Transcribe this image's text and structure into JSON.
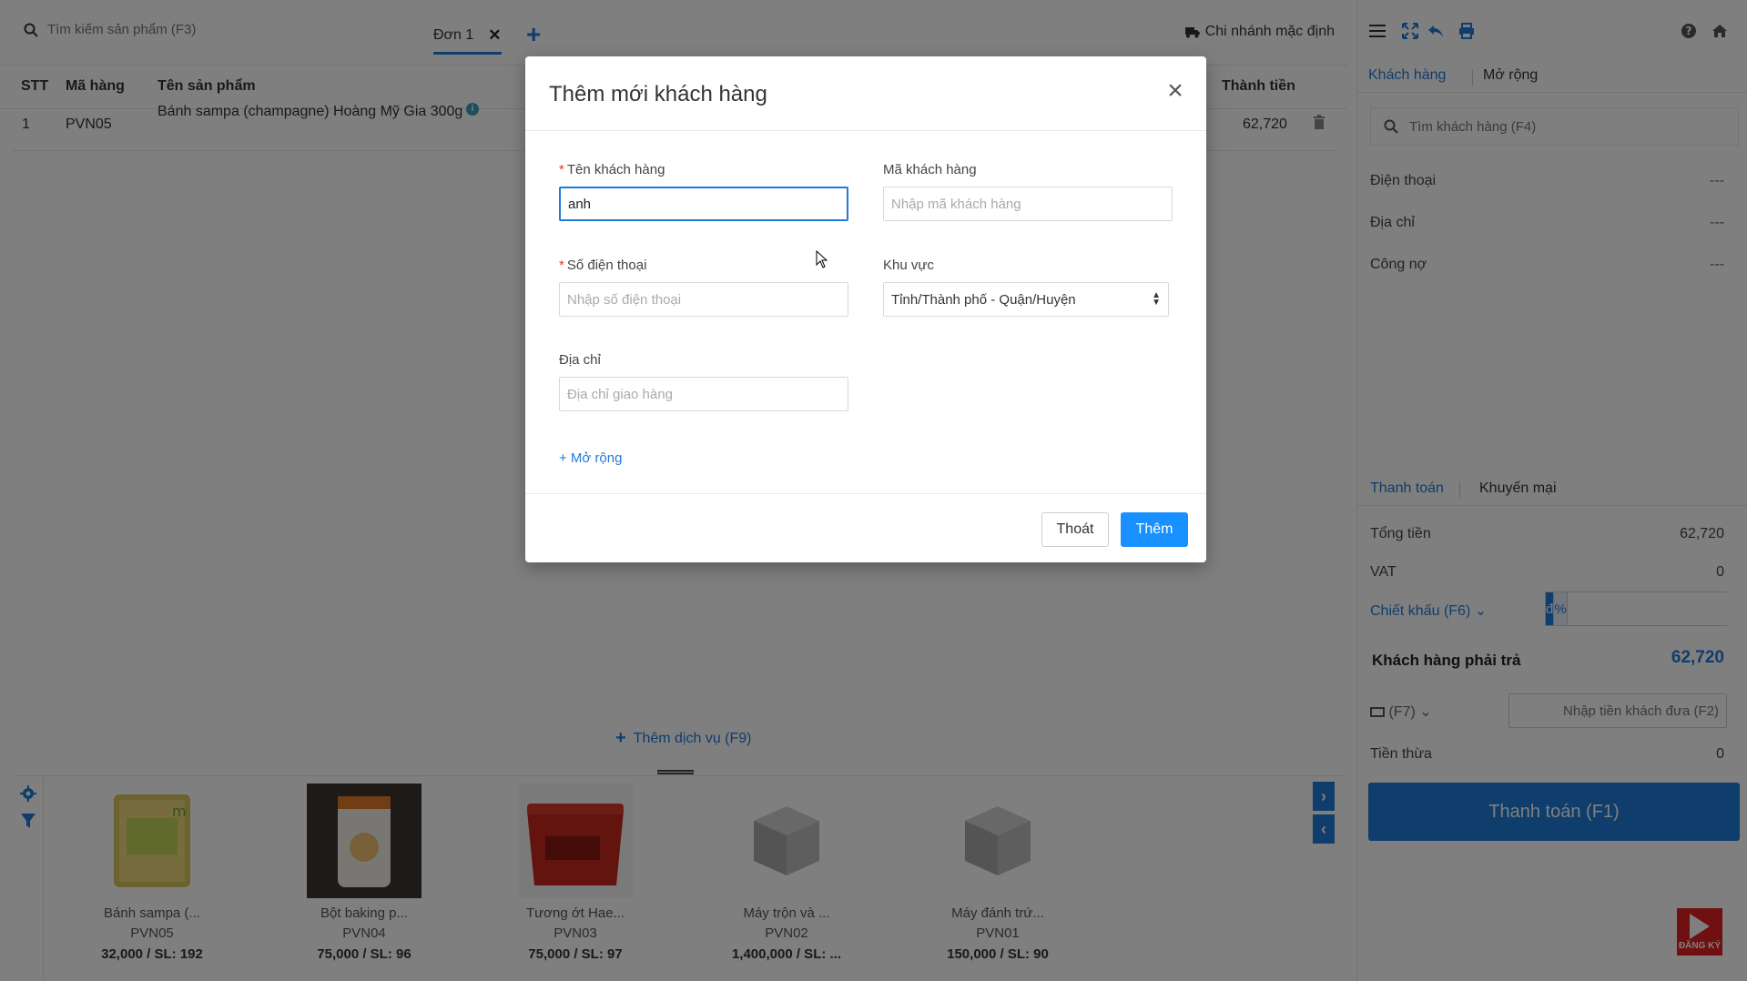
{
  "topbar": {
    "search_placeholder": "Tìm kiếm sản phẩm (F3)",
    "order_tab": "Đơn 1",
    "add_tab": "+",
    "branch": "Chi nhánh mặc định"
  },
  "table": {
    "headers": {
      "stt": "STT",
      "code": "Mã hàng",
      "name": "Tên sản phẩm",
      "total": "Thành tiền"
    },
    "rows": [
      {
        "stt": "1",
        "code": "PVN05",
        "name": "Bánh sampa (champagne) Hoàng Mỹ Gia 300g",
        "total": "62,720"
      }
    ]
  },
  "add_service": "Thêm dịch vụ (F9)",
  "products": [
    {
      "name": "Bánh sampa (...",
      "code": "PVN05",
      "price": "32,000 / SL: 192"
    },
    {
      "name": "Bột baking p...",
      "code": "PVN04",
      "price": "75,000 / SL: 96"
    },
    {
      "name": "Tương ớt Hae...",
      "code": "PVN03",
      "price": "75,000 / SL: 97"
    },
    {
      "name": "Máy trộn và ...",
      "code": "PVN02",
      "price": "1,400,000 / SL: ..."
    },
    {
      "name": "Máy đánh trứ...",
      "code": "PVN01",
      "price": "150,000 / SL: 90"
    }
  ],
  "right": {
    "tabs": {
      "customer": "Khách hàng",
      "extend": "Mở rộng"
    },
    "customer_search_placeholder": "Tìm khách hàng (F4)",
    "phone_label": "Điện thoại",
    "phone_value": "---",
    "address_label": "Địa chỉ",
    "address_value": "---",
    "debt_label": "Công nợ",
    "debt_value": "---",
    "pay_tabs": {
      "payment": "Thanh toán",
      "promo": "Khuyến mại"
    },
    "total_label": "Tổng tiền",
    "total_value": "62,720",
    "vat_label": "VAT",
    "vat_value": "0",
    "discount_label": "Chiết khấu (F6)",
    "discount_d": "đ",
    "discount_p": "%",
    "discount_value": "0",
    "payable_label": "Khách hàng phải trả",
    "payable_value": "62,720",
    "payment_method": "(F7)",
    "cash_placeholder": "Nhập tiền khách đưa (F2)",
    "change_label": "Tiền thừa",
    "change_value": "0",
    "pay_button": "Thanh toán (F1)",
    "badge_text": "ĐĂNG KÝ"
  },
  "modal": {
    "title": "Thêm mới khách hàng",
    "name_label": "Tên khách hàng",
    "name_value": "anh",
    "code_label": "Mã khách hàng",
    "code_placeholder": "Nhập mã khách hàng",
    "phone_label": "Số điện thoại",
    "phone_placeholder": "Nhập số điện thoại",
    "region_label": "Khu vực",
    "region_value": "Tỉnh/Thành phố - Quận/Huyện",
    "address_label": "Địa chỉ",
    "address_placeholder": "Địa chỉ giao hàng",
    "expand": "+ Mở rộng",
    "exit_button": "Thoát",
    "add_button": "Thêm"
  },
  "colors": {
    "accent": "#1f7ad8",
    "primary_button": "#1890ff",
    "required": "#e53935",
    "overlay": "rgba(0,0,0,0.5)"
  }
}
